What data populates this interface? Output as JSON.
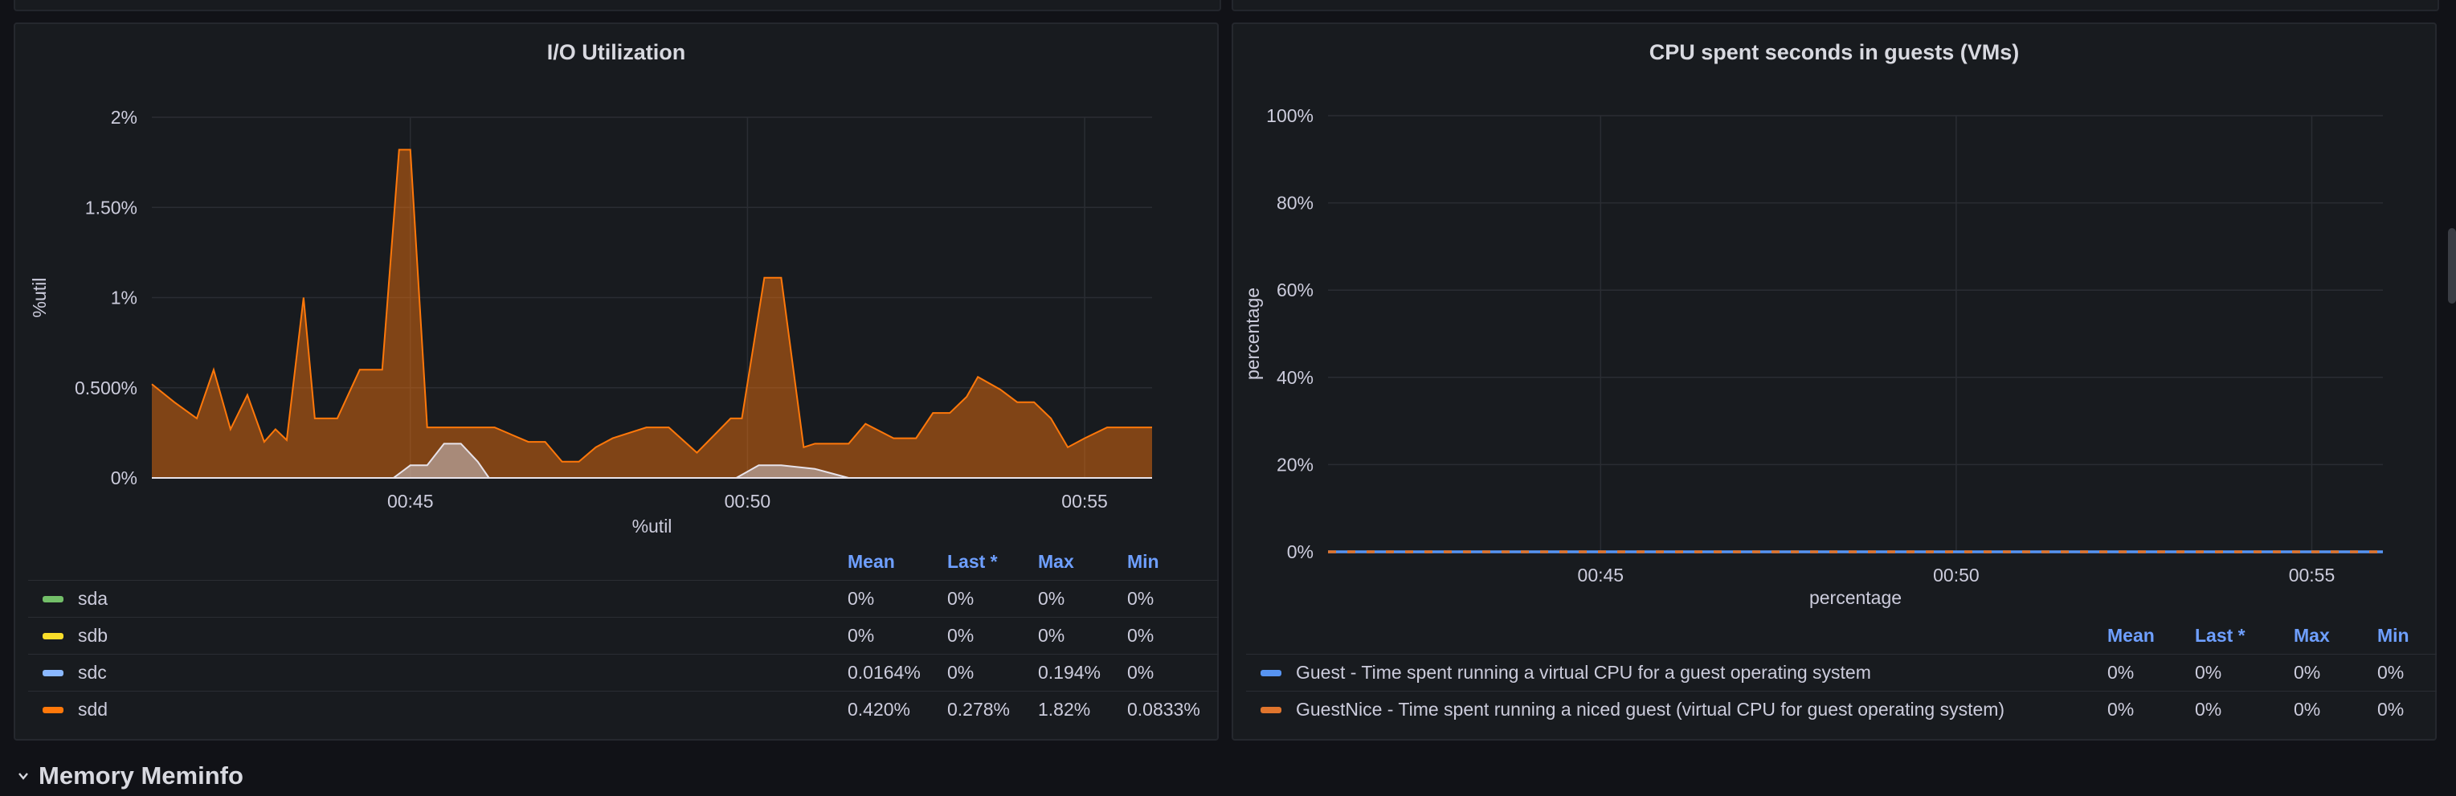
{
  "panels": [
    {
      "title": "I/O Utilization",
      "legend": {
        "columns": [
          "Mean",
          "Last *",
          "Max",
          "Min"
        ],
        "rows": [
          {
            "name": "sda",
            "color": "#73bf69",
            "values": [
              "0%",
              "0%",
              "0%",
              "0%"
            ]
          },
          {
            "name": "sdb",
            "color": "#fade2a",
            "values": [
              "0%",
              "0%",
              "0%",
              "0%"
            ]
          },
          {
            "name": "sdc",
            "color": "#8ab8ff",
            "values": [
              "0.0164%",
              "0%",
              "0.194%",
              "0%"
            ]
          },
          {
            "name": "sdd",
            "color": "#ff780a",
            "values": [
              "0.420%",
              "0.278%",
              "1.82%",
              "0.0833%"
            ]
          }
        ]
      }
    },
    {
      "title": "CPU spent seconds in guests (VMs)",
      "legend": {
        "columns": [
          "Mean",
          "Last *",
          "Max",
          "Min"
        ],
        "rows": [
          {
            "name": "Guest - Time spent running a virtual CPU for a guest operating system",
            "color": "#5794f2",
            "values": [
              "0%",
              "0%",
              "0%",
              "0%"
            ]
          },
          {
            "name": "GuestNice - Time spent running a niced guest (virtual CPU for guest operating system)",
            "color": "#e0752d",
            "values": [
              "0%",
              "0%",
              "0%",
              "0%"
            ]
          }
        ]
      }
    }
  ],
  "section": {
    "title": "Memory Meminfo"
  },
  "chart_data": [
    {
      "type": "area",
      "title": "I/O Utilization",
      "ylabel": "%util",
      "xlabel": "%util",
      "xlim": [
        "00:41:10",
        "00:56:00"
      ],
      "ylim": [
        0,
        2
      ],
      "x_tick_labels": [
        "00:45",
        "00:50",
        "00:55"
      ],
      "y_tick_labels": [
        "0%",
        "0.500%",
        "1%",
        "1.50%",
        "2%"
      ],
      "grid": true,
      "series": [
        {
          "name": "sdd",
          "color": "#ff780a",
          "x": [
            "00:41:10",
            "00:41:30",
            "00:41:50",
            "00:42:05",
            "00:42:20",
            "00:42:35",
            "00:42:50",
            "00:43:00",
            "00:43:10",
            "00:43:25",
            "00:43:35",
            "00:43:45",
            "00:43:55",
            "00:44:15",
            "00:44:35",
            "00:44:50",
            "00:45:00",
            "00:45:15",
            "00:45:30",
            "00:45:40",
            "00:46:15",
            "00:46:45",
            "00:47:00",
            "00:47:15",
            "00:47:30",
            "00:47:45",
            "00:48:00",
            "00:48:30",
            "00:48:50",
            "00:49:15",
            "00:49:45",
            "00:49:55",
            "00:50:15",
            "00:50:30",
            "00:50:50",
            "00:51:00",
            "00:51:30",
            "00:51:45",
            "00:52:10",
            "00:52:30",
            "00:52:45",
            "00:53:00",
            "00:53:15",
            "00:53:25",
            "00:53:45",
            "00:54:00",
            "00:54:15",
            "00:54:30",
            "00:54:45",
            "00:55:00",
            "00:55:20",
            "00:55:45",
            "00:56:00"
          ],
          "y": [
            0.52,
            0.42,
            0.33,
            0.6,
            0.27,
            0.46,
            0.2,
            0.27,
            0.21,
            1.0,
            0.33,
            0.33,
            0.33,
            0.6,
            0.6,
            1.82,
            1.82,
            0.28,
            0.28,
            0.28,
            0.28,
            0.2,
            0.2,
            0.09,
            0.09,
            0.17,
            0.22,
            0.28,
            0.28,
            0.14,
            0.33,
            0.33,
            1.11,
            1.11,
            0.17,
            0.19,
            0.19,
            0.3,
            0.22,
            0.22,
            0.36,
            0.36,
            0.45,
            0.56,
            0.49,
            0.42,
            0.42,
            0.33,
            0.17,
            0.22,
            0.28,
            0.28,
            0.28
          ]
        },
        {
          "name": "sdc",
          "color": "#8ab8ff",
          "x": [
            "00:41:10",
            "00:44:45",
            "00:45:00",
            "00:45:15",
            "00:45:30",
            "00:45:45",
            "00:46:00",
            "00:46:10",
            "00:49:50",
            "00:50:10",
            "00:50:30",
            "00:51:00",
            "00:51:30",
            "00:52:00",
            "00:56:00"
          ],
          "y": [
            0,
            0,
            0.07,
            0.07,
            0.19,
            0.19,
            0.09,
            0,
            0,
            0.07,
            0.07,
            0.05,
            0,
            0,
            0
          ]
        },
        {
          "name": "sda",
          "color": "#73bf69",
          "x": [
            "00:41:10",
            "00:56:00"
          ],
          "y": [
            0,
            0
          ]
        },
        {
          "name": "sdb",
          "color": "#fade2a",
          "x": [
            "00:41:10",
            "00:56:00"
          ],
          "y": [
            0,
            0
          ]
        }
      ]
    },
    {
      "type": "line",
      "title": "CPU spent seconds in guests (VMs)",
      "ylabel": "percentage",
      "xlabel": "percentage",
      "xlim": [
        "00:41:10",
        "00:56:00"
      ],
      "ylim": [
        0,
        100
      ],
      "x_tick_labels": [
        "00:45",
        "00:50",
        "00:55"
      ],
      "y_tick_labels": [
        "0%",
        "20%",
        "40%",
        "60%",
        "80%",
        "100%"
      ],
      "grid": true,
      "series": [
        {
          "name": "Guest - Time spent running a virtual CPU for a guest operating system",
          "color": "#5794f2",
          "x": [
            "00:41:10",
            "00:56:00"
          ],
          "y": [
            0,
            0
          ]
        },
        {
          "name": "GuestNice - Time spent running a niced guest (virtual CPU for guest operating system)",
          "color": "#e0752d",
          "x": [
            "00:41:10",
            "00:56:00"
          ],
          "y": [
            0,
            0
          ],
          "dashed": true
        }
      ]
    }
  ]
}
